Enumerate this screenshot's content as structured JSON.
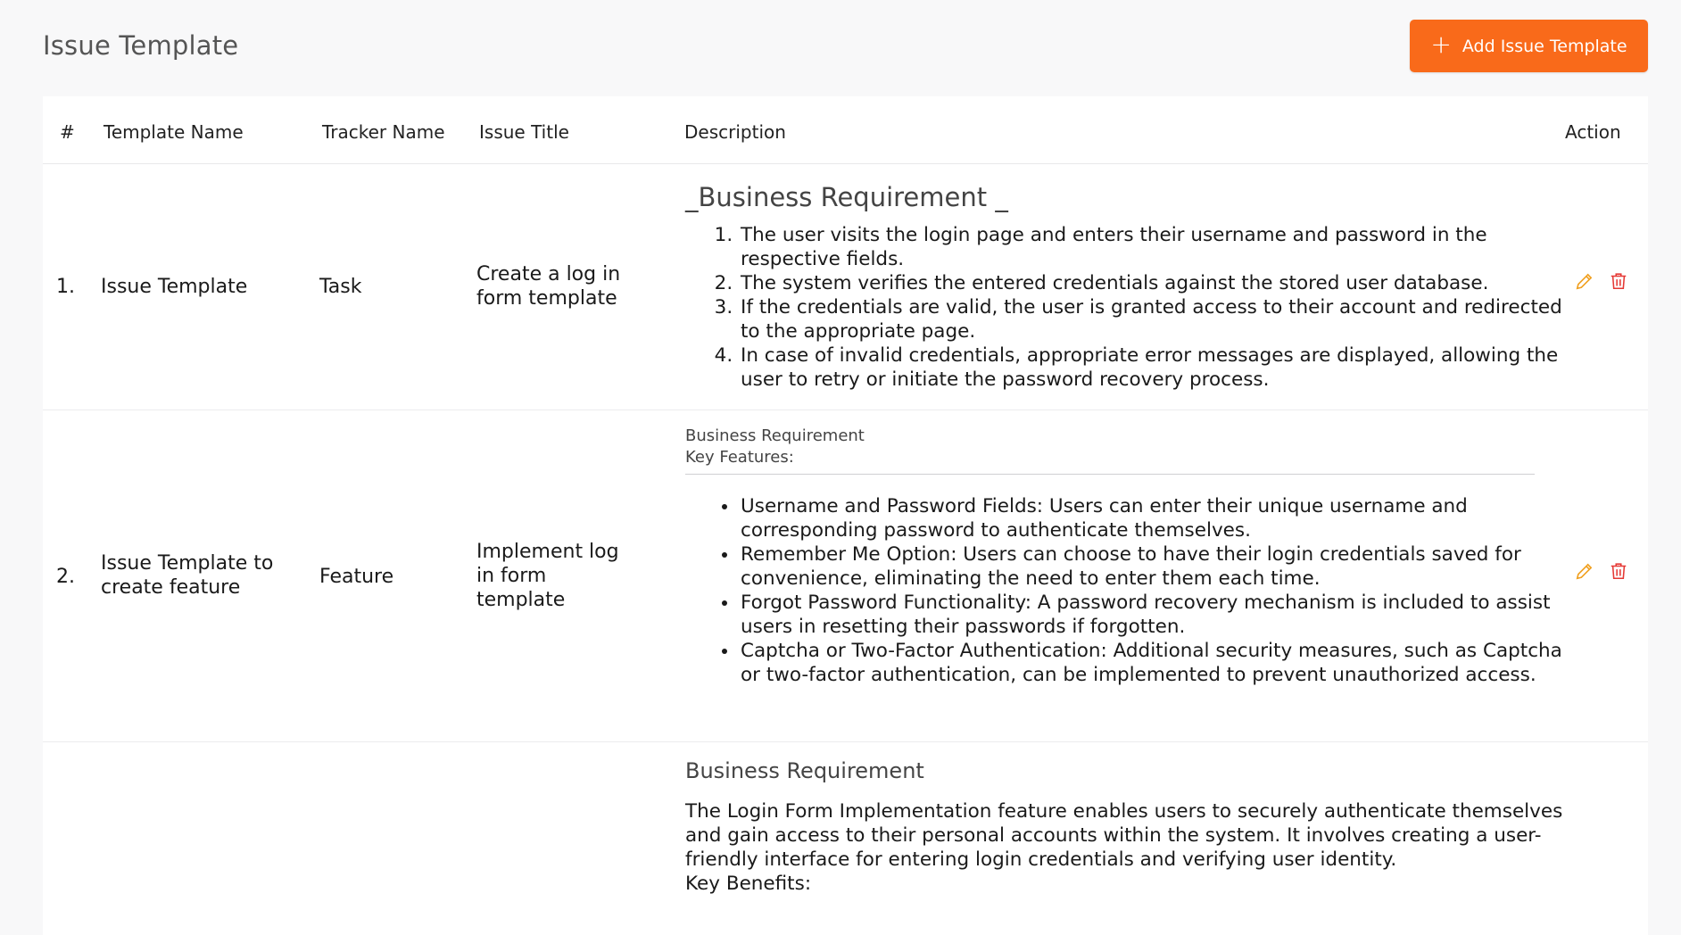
{
  "page": {
    "title": "Issue Template",
    "add_button_label": "Add Issue Template"
  },
  "table": {
    "headers": [
      "#",
      "Template Name",
      "Tracker Name",
      "Issue Title",
      "Description",
      "Action"
    ],
    "rows": [
      {
        "index": "1.",
        "template_name": "Issue Template",
        "tracker_name": "Task",
        "issue_title_lines": [
          "Create a log in",
          "form template"
        ],
        "description": {
          "heading": "_Business Requirement _",
          "items": [
            "The user visits the login page and enters their username and password in the respective fields.",
            "The system verifies the entered credentials against the stored user database.",
            "If the credentials are valid, the user is granted access to their account and redirected to the appropriate page.",
            "In case of invalid credentials, appropriate error messages are displayed, allowing the user to retry or initiate the password recovery process."
          ]
        }
      },
      {
        "index": "2.",
        "template_name_lines": [
          "Issue Template to",
          "create feature"
        ],
        "tracker_name": "Feature",
        "issue_title_lines": [
          "Implement log",
          "in form",
          "template"
        ],
        "description": {
          "line1": "Business Requirement",
          "line2": "Key Features:",
          "items": [
            "Username and Password Fields: Users can enter their unique username and corresponding password to authenticate themselves.",
            "Remember Me Option: Users can choose to have their login credentials saved for convenience, eliminating the need to enter them each time.",
            "Forgot Password Functionality: A password recovery mechanism is included to assist users in resetting their passwords if forgotten.",
            "Captcha or Two-Factor Authentication: Additional security measures, such as Captcha or two-factor authentication, can be implemented to prevent unauthorized access."
          ]
        }
      },
      {
        "description": {
          "heading": "Business Requirement",
          "paragraph": "The Login Form Implementation feature enables users to securely authenticate themselves and gain access to their personal accounts within the system. It involves creating a user-friendly interface for entering login credentials and verifying user identity.",
          "trailing": "Key Benefits:"
        }
      }
    ]
  },
  "colors": {
    "accent": "#f96a1a",
    "edit_icon": "#f0a020",
    "delete_icon": "#e53935"
  },
  "icons": {
    "add": "plus-icon",
    "edit": "pencil-icon",
    "delete": "trash-icon"
  }
}
